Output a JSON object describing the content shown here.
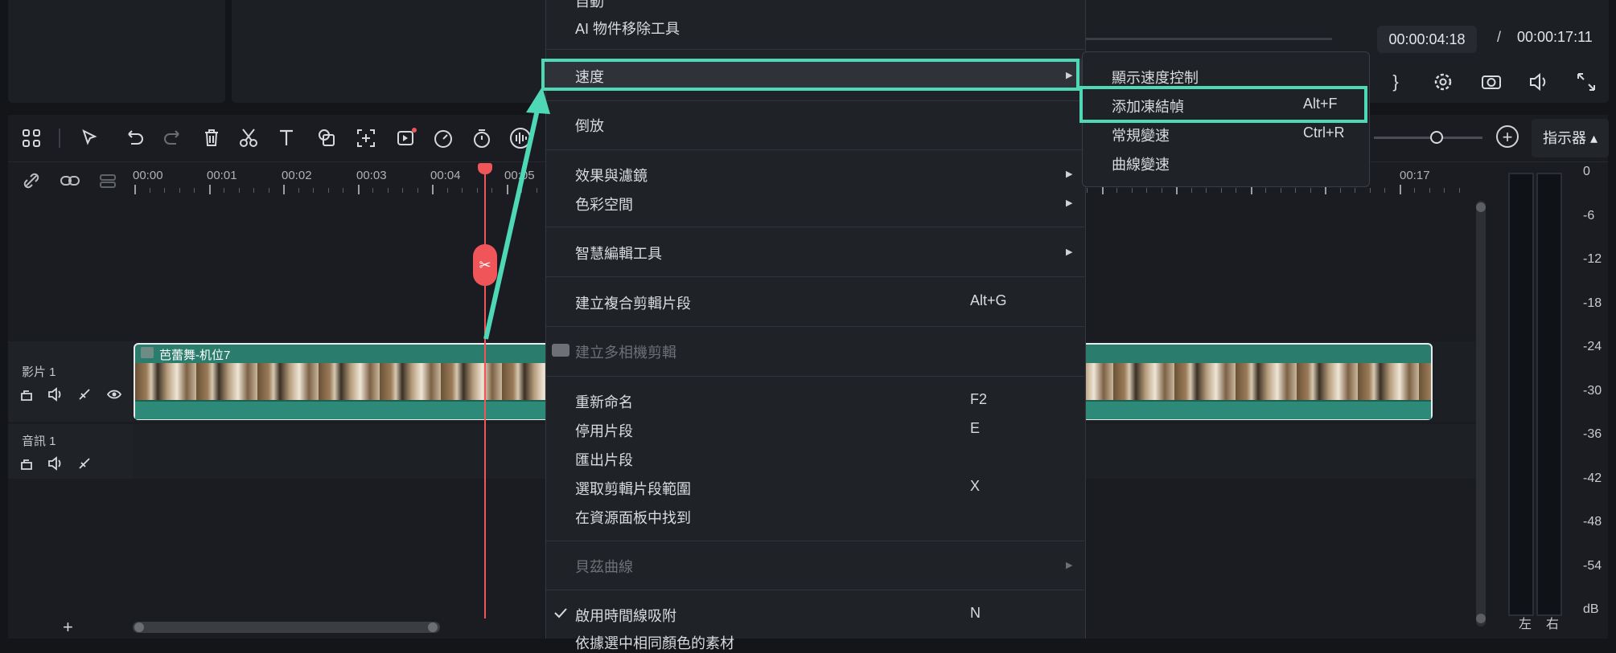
{
  "preview": {
    "current_time": "00:00:04:18",
    "separator": "/",
    "total_time": "00:00:17:11",
    "icons": [
      "bracket-close-icon",
      "settings-icon",
      "camera-icon",
      "volume-icon",
      "fullscreen-icon"
    ],
    "bracket": "}"
  },
  "toolbar": {
    "icons": [
      "grid-icon",
      "select-icon",
      "undo-icon",
      "redo-icon",
      "delete-icon",
      "scissors-icon",
      "text-icon",
      "shape-icon",
      "crop-icon",
      "ai-video-icon",
      "speed-icon",
      "timer-icon",
      "audio-icon"
    ],
    "meter_button": "指示器 ▴"
  },
  "ruler": {
    "labels": [
      "00:00",
      "00:01",
      "00:02",
      "00:03",
      "00:04",
      "00:05",
      "00:17"
    ]
  },
  "tracks": {
    "video_label": "影片 1",
    "audio_label": "音訊 1",
    "clip_name": "芭蕾舞-机位7"
  },
  "meter": {
    "scale": [
      "0",
      "-6",
      "-12",
      "-18",
      "-24",
      "-30",
      "-36",
      "-42",
      "-48",
      "-54",
      "dB"
    ],
    "left": "左",
    "right": "右"
  },
  "menu": {
    "top_partial": "自動",
    "ai_object_removal": "AI 物件移除工具",
    "speed": "速度",
    "reverse": "倒放",
    "effects": "效果與濾鏡",
    "color_space": "色彩空間",
    "smart_tools": "智慧編輯工具",
    "compound_clip": "建立複合剪輯片段",
    "compound_clip_sc": "Alt+G",
    "multicam": "建立多相機剪輯",
    "rename": "重新命名",
    "rename_sc": "F2",
    "disable_clip": "停用片段",
    "disable_clip_sc": "E",
    "export_clip": "匯出片段",
    "select_range": "選取剪輯片段範圍",
    "select_range_sc": "X",
    "find_in_media": "在資源面板中找到",
    "bezier": "貝茲曲線",
    "enable_snap": "啟用時間線吸附",
    "enable_snap_sc": "N",
    "bottom_partial": "依據選中相同顏色的素材"
  },
  "submenu": {
    "show_speed": "顯示速度控制",
    "freeze_frame": "添加凍結幀",
    "freeze_frame_sc": "Alt+F",
    "uniform_speed": "常規變速",
    "uniform_speed_sc": "Ctrl+R",
    "curve_speed": "曲線變速"
  },
  "colors": {
    "highlight": "#4fd8b6",
    "playhead": "#f0555a",
    "clip": "#2a7c6d"
  }
}
